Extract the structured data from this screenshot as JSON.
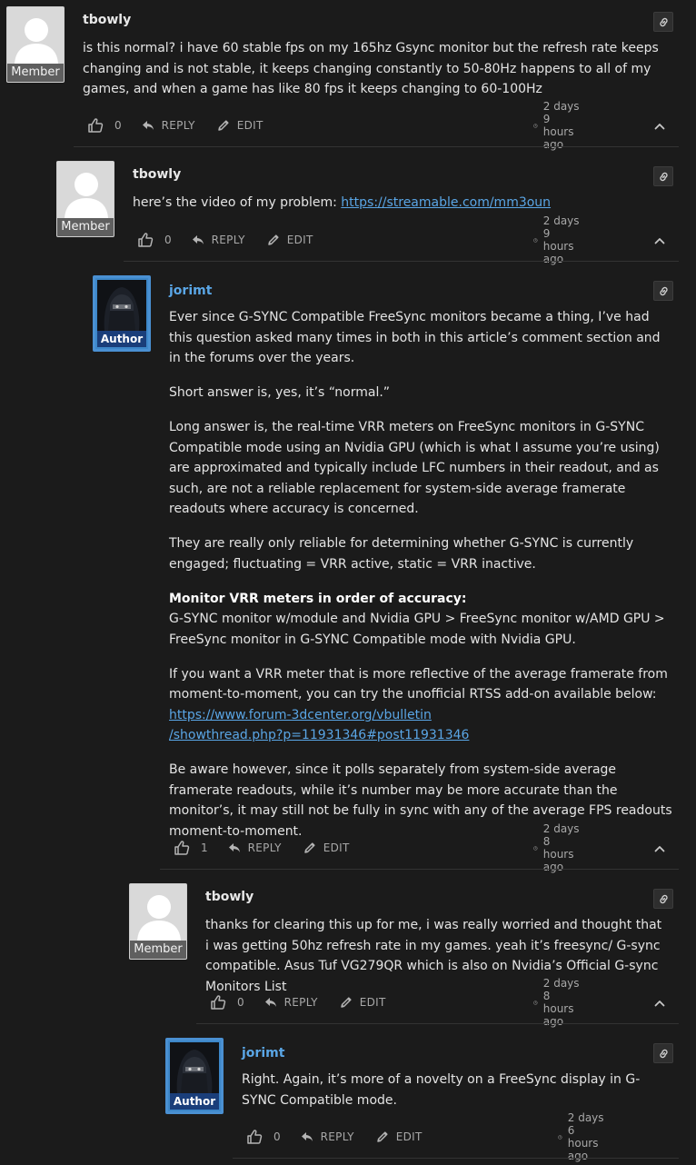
{
  "comments": [
    {
      "author": "tbowly",
      "role": "Member",
      "paragraphs": [
        "is this normal? i have 60 stable fps on my 165hz Gsync monitor but the refresh rate keeps changing and is not stable, it keeps changing constantly to 50-80Hz happens to all of my games, and when a game has like 80 fps it keeps changing to 60-100Hz"
      ],
      "likes": "0",
      "reply_label": "REPLY",
      "edit_label": "EDIT",
      "time": "2 days 9 hours ago"
    },
    {
      "author": "tbowly",
      "role": "Member",
      "text_prefix": "here’s the video of my problem: ",
      "link": "https://streamable.com/mm3oun",
      "likes": "0",
      "reply_label": "REPLY",
      "edit_label": "EDIT",
      "time": "2 days 9 hours ago"
    },
    {
      "author": "jorimt",
      "role": "Author",
      "p1": "Ever since G-SYNC Compatible FreeSync monitors became a thing, I’ve had this question asked many times in both in this article’s comment section and in the forums over the years.",
      "p2": "Short answer is, yes, it’s “normal.”",
      "p3": "Long answer is, the real-time VRR meters on FreeSync monitors in G-SYNC Compatible mode using an Nvidia GPU (which is what I assume you’re using) are approximated and typically include LFC numbers in their readout, and as such, are not a reliable replacement for system-side average framerate readouts where accuracy is concerned.",
      "p4": "They are really only reliable for determining whether G-SYNC is currently engaged; fluctuating = VRR active, static = VRR inactive.",
      "p5_heading": "Monitor VRR meters in order of accuracy:",
      "p5_text": "G-SYNC monitor w/module and Nvidia GPU > FreeSync monitor w/AMD GPU > FreeSync monitor in G-SYNC Compatible mode with Nvidia GPU.",
      "p6": "If you want a VRR meter that is more reflective of the average framerate from moment-to-moment, you can try the unofficial RTSS add-on available below:",
      "p6_link_line1": "https://www.forum-3dcenter.org/vbulletin",
      "p6_link_line2": "/showthread.php?p=11931346#post11931346",
      "p7": "Be aware however, since it polls separately from system-side average framerate readouts, while it’s number may be more accurate than the monitor’s, it may still not be fully in sync with any of the average FPS readouts moment-to-moment.",
      "likes": "1",
      "reply_label": "REPLY",
      "edit_label": "EDIT",
      "time": "2 days 8 hours ago"
    },
    {
      "author": "tbowly",
      "role": "Member",
      "text": "thanks for clearing this up for me, i was really worried and thought that i was getting 50hz refresh rate in my games. yeah it’s freesync/ G-sync compatible. Asus Tuf VG279QR which is also on Nvidia’s Official G-sync Monitors List",
      "likes": "0",
      "reply_label": "REPLY",
      "edit_label": "EDIT",
      "time": "2 days 8 hours ago"
    },
    {
      "author": "jorimt",
      "role": "Author",
      "text": "Right. Again, it’s more of a novelty on a FreeSync display in G-SYNC Compatible mode.",
      "likes": "0",
      "reply_label": "REPLY",
      "edit_label": "EDIT",
      "time": "2 days 6 hours ago"
    }
  ],
  "icons": {
    "like": "thumbs-up-icon",
    "reply": "reply-arrow-icon",
    "edit": "pencil-icon",
    "time": "clock-icon",
    "permalink": "link-icon",
    "collapse": "chevron-up-icon"
  },
  "colors": {
    "background": "#1b1b1b",
    "link": "#5aa6e6",
    "author_badge": "#1a3e7a",
    "member_badge": "#5f5f5f"
  }
}
